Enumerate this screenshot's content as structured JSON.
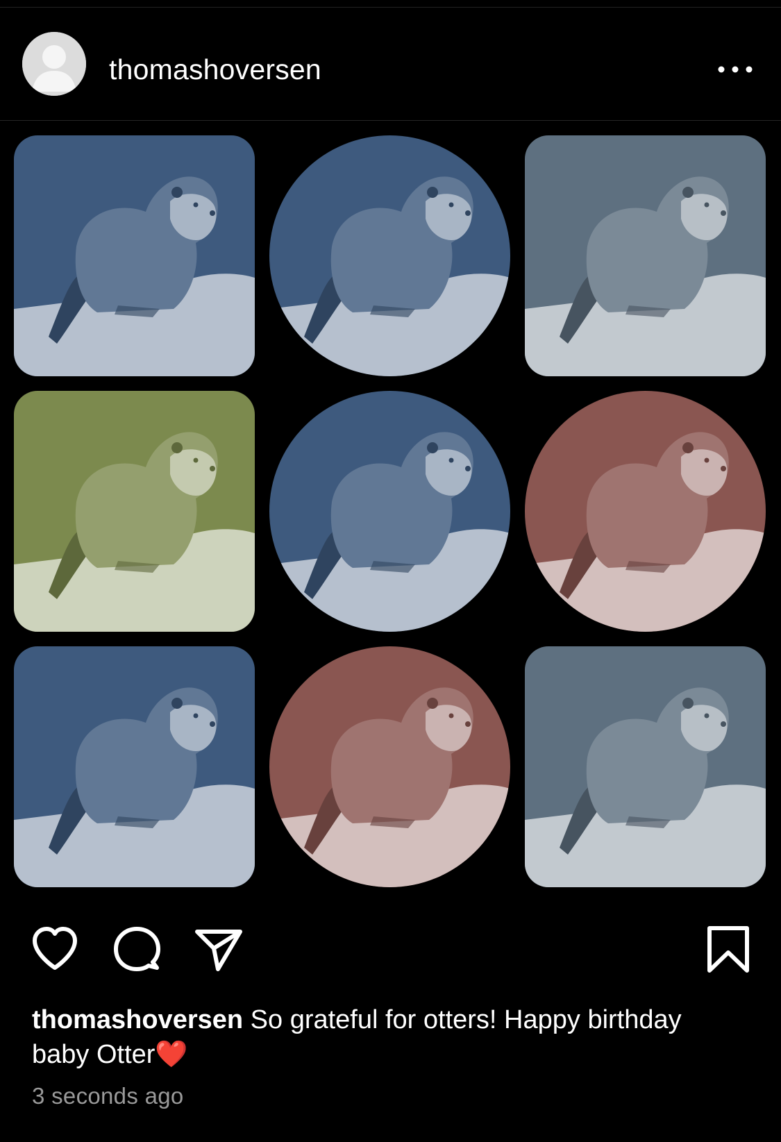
{
  "post": {
    "username": "thomashoversen",
    "caption_user": "thomashoversen",
    "caption_text": " So grateful for otters! Happy birthday baby Otter",
    "caption_emoji": "❤️",
    "timestamp": "3 seconds ago"
  },
  "icons": {
    "more": "more-horizontal-icon",
    "like": "heart-icon",
    "comment": "comment-icon",
    "share": "share-icon",
    "save": "bookmark-icon"
  },
  "grid": {
    "rows": 3,
    "cols": 3,
    "tiles": [
      {
        "shape": "rounded",
        "tint": "#3e5a7e"
      },
      {
        "shape": "circle",
        "tint": "#3e5a7e"
      },
      {
        "shape": "rounded",
        "tint": "#5e7080"
      },
      {
        "shape": "rounded",
        "tint": "#7c8a4e"
      },
      {
        "shape": "circle",
        "tint": "#3e5a7e"
      },
      {
        "shape": "circle",
        "tint": "#8a5651"
      },
      {
        "shape": "rounded",
        "tint": "#3e5a7e"
      },
      {
        "shape": "circle",
        "tint": "#8a5651"
      },
      {
        "shape": "rounded",
        "tint": "#5e7080"
      }
    ]
  }
}
